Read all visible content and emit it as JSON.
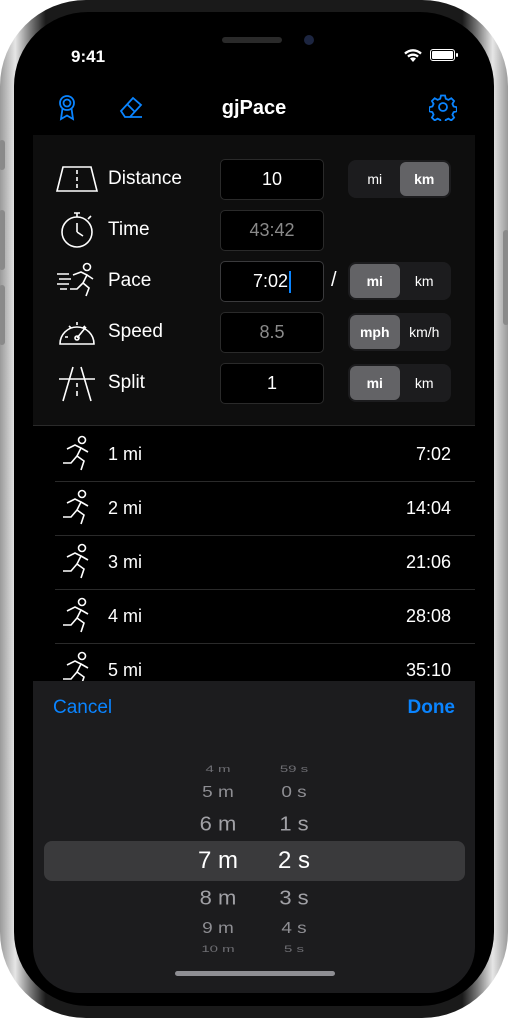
{
  "status": {
    "time": "9:41"
  },
  "navbar": {
    "title": "gjPace",
    "left_icons": [
      "award-ribbon-icon",
      "eraser-icon"
    ],
    "right_icon": "gear-icon"
  },
  "form": {
    "rows": [
      {
        "label": "Distance",
        "icon": "road-icon",
        "value": "10",
        "segment": [
          "mi",
          "km"
        ],
        "selected": 1
      },
      {
        "label": "Time",
        "icon": "stopwatch-icon",
        "value": "43:42"
      },
      {
        "label": "Pace",
        "icon": "runner-fast-icon",
        "value": "7:02",
        "separator": "/",
        "segment": [
          "mi",
          "km"
        ],
        "selected": 0
      },
      {
        "label": "Speed",
        "icon": "speedometer-icon",
        "value": "8.5",
        "segment": [
          "mph",
          "km/h"
        ],
        "selected": 0
      },
      {
        "label": "Split",
        "icon": "highway-icon",
        "value": "1",
        "segment": [
          "mi",
          "km"
        ],
        "selected": 0
      }
    ]
  },
  "splits": [
    {
      "label": "1 mi",
      "time": "7:02"
    },
    {
      "label": "2 mi",
      "time": "14:04"
    },
    {
      "label": "3 mi",
      "time": "21:06"
    },
    {
      "label": "4 mi",
      "time": "28:08"
    },
    {
      "label": "5 mi",
      "time": "35:10"
    }
  ],
  "picker_bar": {
    "cancel": "Cancel",
    "done": "Done"
  },
  "picker": {
    "minutes": [
      "4 m",
      "5 m",
      "6 m",
      "7 m",
      "8 m",
      "9 m",
      "10 m"
    ],
    "seconds": [
      "59 s",
      "0 s",
      "1 s",
      "2 s",
      "3 s",
      "4 s",
      "5 s"
    ],
    "selected_index": 3
  },
  "colors": {
    "accent": "#0a84ff",
    "background": "#000000",
    "segment_selected": "#636366"
  }
}
